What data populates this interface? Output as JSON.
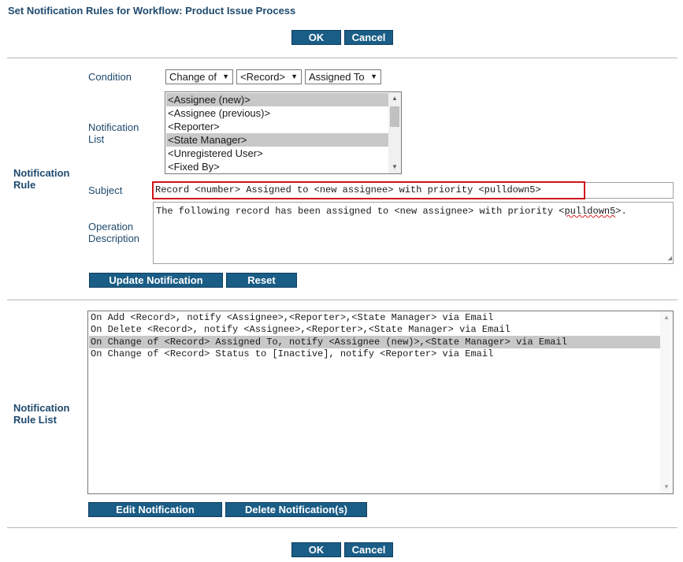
{
  "page": {
    "title": "Set Notification Rules for Workflow: Product Issue Process"
  },
  "top_actions": {
    "ok_label": "OK",
    "cancel_label": "Cancel"
  },
  "bottom_actions": {
    "ok_label": "OK",
    "cancel_label": "Cancel"
  },
  "notification_rule": {
    "section_label_line1": "Notification",
    "section_label_line2": "Rule",
    "condition": {
      "label": "Condition",
      "event_value": "Change of",
      "record_value": "<Record>",
      "field_value": "Assigned To"
    },
    "notification_list": {
      "label_line1": "Notification",
      "label_line2": "List",
      "options": [
        {
          "label": "<Assignee (new)>",
          "selected": true
        },
        {
          "label": "<Assignee (previous)>",
          "selected": false
        },
        {
          "label": "<Reporter>",
          "selected": false
        },
        {
          "label": "<State Manager>",
          "selected": true
        },
        {
          "label": "<Unregistered User>",
          "selected": false
        },
        {
          "label": "<Fixed By>",
          "selected": false
        }
      ]
    },
    "subject": {
      "label": "Subject",
      "value": "Record <number> Assigned to <new assignee> with priority <pulldown5>"
    },
    "operation_description": {
      "label_line1": "Operation",
      "label_line2": "Description",
      "value_prefix": "The following record has been assigned to <new assignee> with priority <",
      "value_misspelled": "pulldown5",
      "value_suffix": ">."
    },
    "update_label": "Update Notification",
    "reset_label": "Reset"
  },
  "rule_list": {
    "section_label_line1": "Notification",
    "section_label_line2": "Rule List",
    "rows": [
      {
        "text": "On Add <Record>, notify <Assignee>,<Reporter>,<State Manager> via Email",
        "selected": false
      },
      {
        "text": "On Delete <Record>, notify <Assignee>,<Reporter>,<State Manager> via Email",
        "selected": false
      },
      {
        "text": "On Change of <Record> Assigned To, notify <Assignee (new)>,<State Manager> via Email",
        "selected": true
      },
      {
        "text": "On Change of <Record> Status to [Inactive], notify <Reporter> via Email",
        "selected": false
      }
    ],
    "edit_label": "Edit Notification",
    "delete_label": "Delete Notification(s)"
  },
  "colors": {
    "button_bg": "#1a5d86",
    "label_text": "#1f4a6e",
    "selection_bg": "#c8c8c8",
    "highlight_border": "#d0141b"
  },
  "icons": {
    "dropdown": "chevron-down-icon",
    "scroll_up": "scroll-up-icon",
    "scroll_down": "scroll-down-icon",
    "resize": "resize-grip-icon"
  }
}
